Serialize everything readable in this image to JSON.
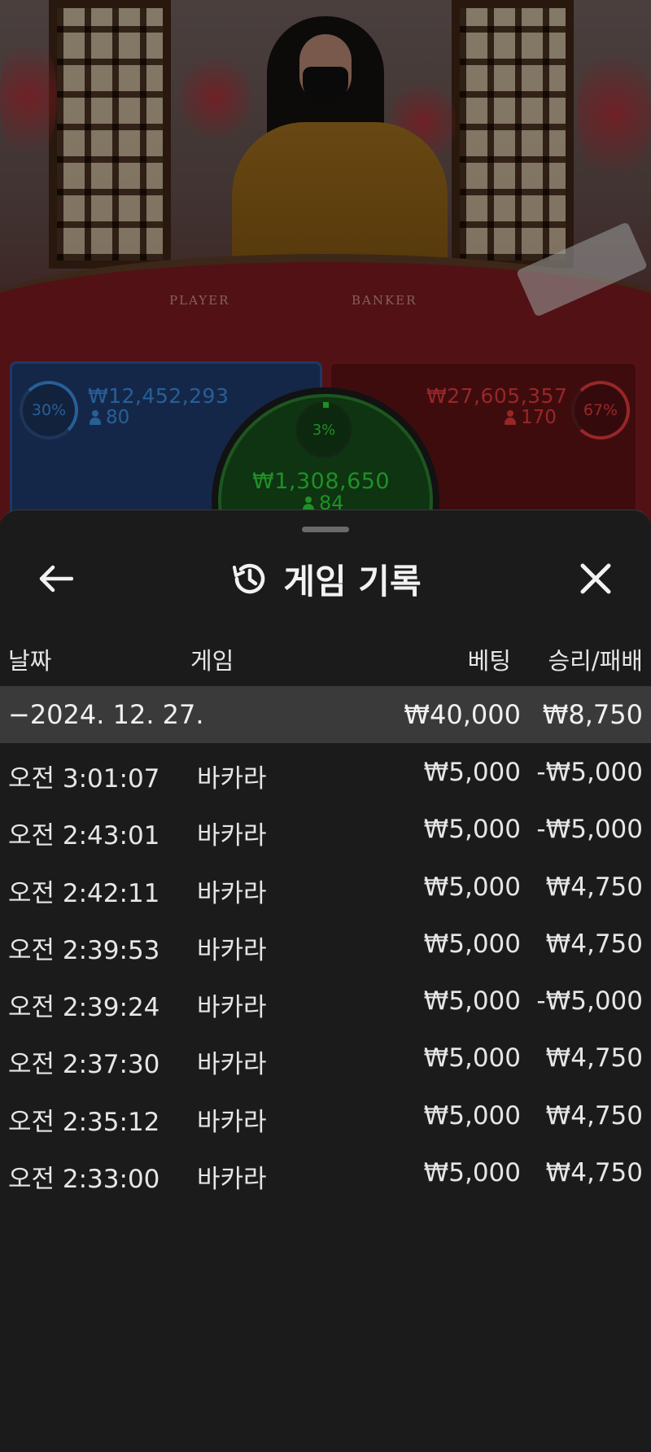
{
  "stream": {
    "table_labels": {
      "player": "PLAYER",
      "banker": "BANKER"
    }
  },
  "bets": {
    "player": {
      "percent": "30%",
      "amount": "₩12,452,293",
      "players": "80",
      "color": "#3a8de0"
    },
    "tie": {
      "percent": "3%",
      "amount": "₩1,308,650",
      "players": "84",
      "color": "#2fd33a"
    },
    "banker": {
      "percent": "67%",
      "amount": "₩27,605,357",
      "players": "170",
      "color": "#e03a3a"
    }
  },
  "sheet": {
    "title": "게임 기록",
    "back_icon": "arrow-left-icon",
    "history_icon": "history-clock-icon",
    "close_icon": "close-icon",
    "columns": {
      "date": "날짜",
      "game": "게임",
      "bet": "베팅",
      "result": "승리/패배"
    },
    "summary": {
      "date": "−2024. 12. 27.",
      "bet": "₩40,000",
      "result": "₩8,750"
    },
    "rows": [
      {
        "time": "오전 3:01:07",
        "game": "바카라",
        "bet": "₩5,000",
        "result": "-₩5,000"
      },
      {
        "time": "오전 2:43:01",
        "game": "바카라",
        "bet": "₩5,000",
        "result": "-₩5,000"
      },
      {
        "time": "오전 2:42:11",
        "game": "바카라",
        "bet": "₩5,000",
        "result": "₩4,750"
      },
      {
        "time": "오전 2:39:53",
        "game": "바카라",
        "bet": "₩5,000",
        "result": "₩4,750"
      },
      {
        "time": "오전 2:39:24",
        "game": "바카라",
        "bet": "₩5,000",
        "result": "-₩5,000"
      },
      {
        "time": "오전 2:37:30",
        "game": "바카라",
        "bet": "₩5,000",
        "result": "₩4,750"
      },
      {
        "time": "오전 2:35:12",
        "game": "바카라",
        "bet": "₩5,000",
        "result": "₩4,750"
      },
      {
        "time": "오전 2:33:00",
        "game": "바카라",
        "bet": "₩5,000",
        "result": "₩4,750"
      }
    ]
  }
}
